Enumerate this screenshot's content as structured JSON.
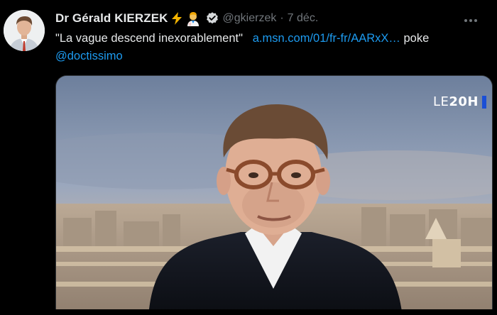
{
  "tweet": {
    "display_name": "Dr Gérald KIERZEK",
    "handle": "@gkierzek",
    "separator": "·",
    "date": "7 déc.",
    "text_quote": "\"La vague descend inexorablement\"",
    "text_link": "a.msn.com/01/fr-fr/AARxX…",
    "text_after": "poke",
    "mention": "@doctissimo",
    "icons": {
      "name_emoji_1": "lightning-icon",
      "name_emoji_2": "health-worker-icon",
      "verified": "verified-badge-icon",
      "more": "more-options-icon"
    }
  },
  "media": {
    "channel_logo_prefix": "LE",
    "channel_logo_main": "20H"
  },
  "colors": {
    "background": "#000000",
    "primary_text": "#e7e9ea",
    "secondary_text": "#71767b",
    "link": "#1d9bf0"
  }
}
